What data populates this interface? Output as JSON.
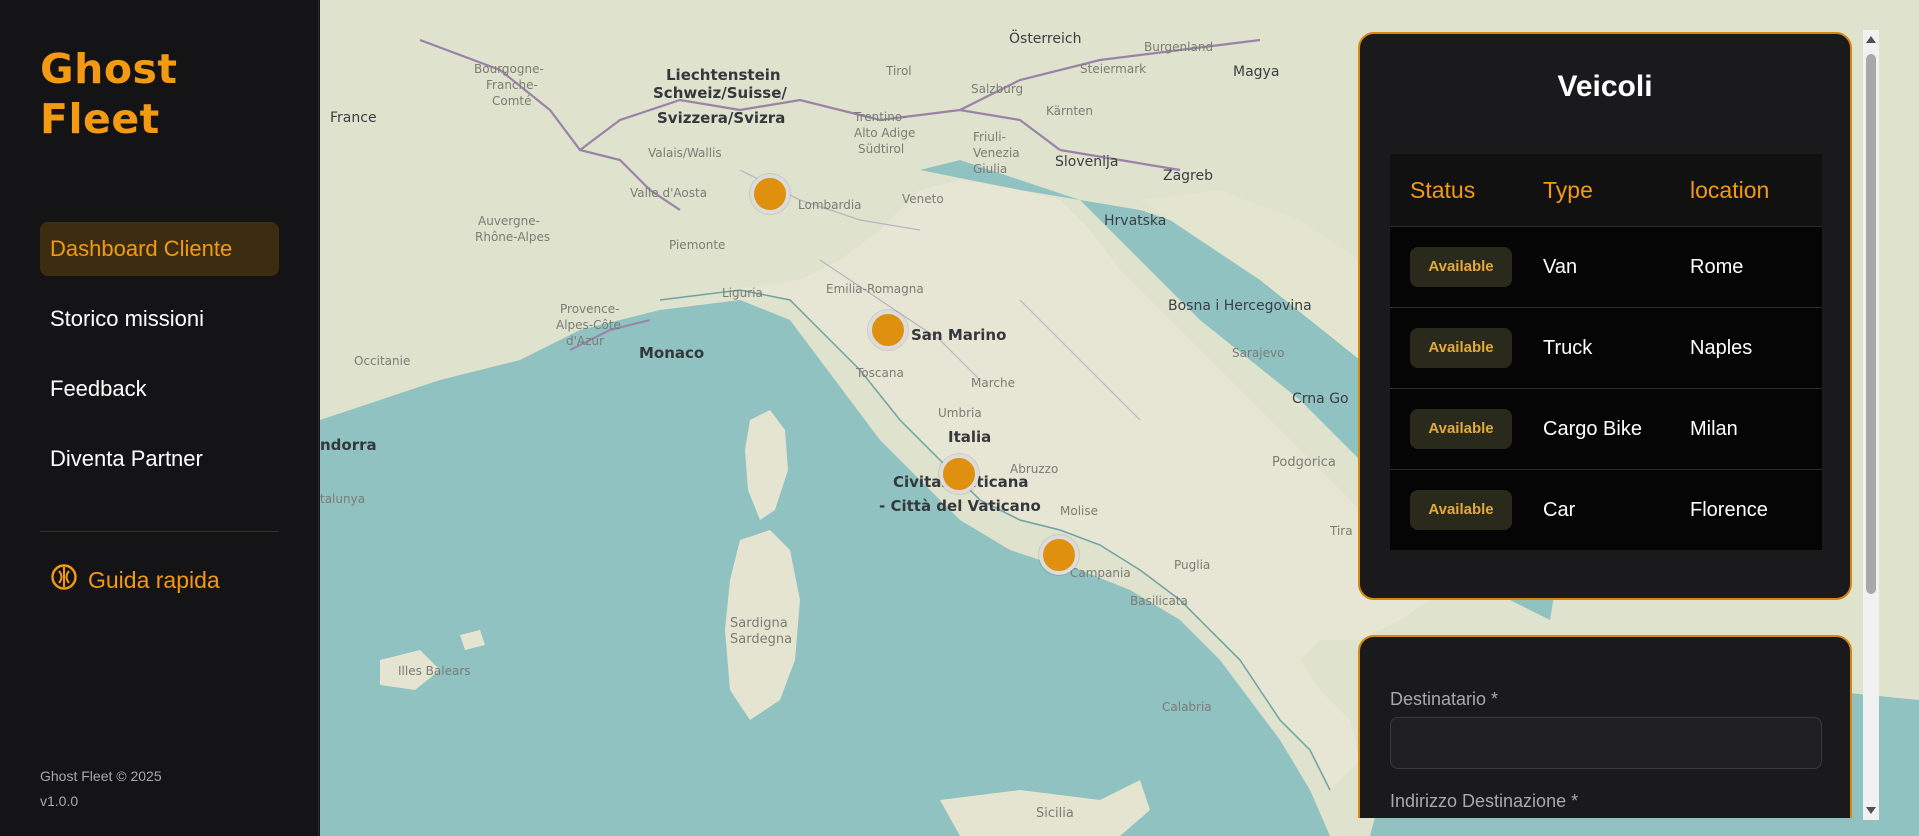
{
  "app": {
    "logo_line1": "Ghost",
    "logo_line2": "Fleet"
  },
  "sidebar": {
    "items": [
      {
        "label": "Dashboard Cliente",
        "active": true
      },
      {
        "label": "Storico missioni",
        "active": false
      },
      {
        "label": "Feedback",
        "active": false
      },
      {
        "label": "Diventa Partner",
        "active": false
      }
    ],
    "guide_label": "Guida rapida",
    "guide_icon": "help-circle-icon",
    "copyright": "Ghost Fleet © 2025",
    "version": "v1.0.0"
  },
  "map": {
    "labels": {
      "france": "France",
      "liechtenstein": "Liechtenstein",
      "switzerland1": "Schweiz/Suisse/",
      "switzerland2": "Svizzera/Svizra",
      "austria": "Österreich",
      "slovenia": "Slovenija",
      "zagreb": "Zagreb",
      "croatia": "Hrvatska",
      "bosnia": "Bosna i Hercegovina",
      "sarajevo": "Sarajevo",
      "monaco": "Monaco",
      "sanmarino": "San Marino",
      "italia": "Italia",
      "vatican1": "Civitas Vaticana",
      "vatican2": "- Città del Vaticano",
      "andorra": "ndorra",
      "podgorica": "Podgorica",
      "crnagora": "Crna Go",
      "magyar": "Magya",
      "sardegna1": "Sardigna",
      "sardegna2": "Sardegna",
      "baleares": "Illes Balears",
      "sicilia": "Sicilia",
      "puglia": "Puglia",
      "calabria": "Calabria",
      "campania": "Campania",
      "toscana": "Toscana",
      "lombardia": "Lombardia",
      "piemonte": "Piemonte",
      "liguria": "Liguria",
      "emilia": "Emilia-Romagna",
      "veneto": "Veneto",
      "marche": "Marche",
      "umbria": "Umbria",
      "abruzzo": "Abruzzo",
      "molise": "Molise",
      "basilicata": "Basilicata",
      "tirol": "Tirol",
      "occitanie": "Occitanie",
      "auvergne1": "Auvergne-",
      "auvergne2": "Rhône-Alpes",
      "bourgogne1": "Bourgogne-",
      "bourgogne2": "Franche-",
      "bourgogne3": "Comté",
      "provence1": "Provence-",
      "provence2": "Alpes-Côte",
      "provence3": "d'Azur",
      "valais": "Valais/Wallis",
      "valleaosta": "Valle d'Aosta",
      "trentino1": "Trentino-",
      "trentino2": "Alto Adige",
      "trentino3": "Südtirol",
      "friuli1": "Friuli-",
      "friuli2": "Venezia",
      "friuli3": "Giulia",
      "karnten": "Kärnten",
      "steiermark": "Steiermark",
      "salzburg": "Salzburg",
      "burgenland": "Burgenland",
      "tira": "Tira",
      "catalunya": "talunya"
    },
    "markers": [
      "marker-milan",
      "marker-florence",
      "marker-rome",
      "marker-naples"
    ]
  },
  "vehicles": {
    "title": "Veicoli",
    "columns": [
      "Status",
      "Type",
      "location"
    ],
    "rows": [
      {
        "status": "Available",
        "type": "Van",
        "location": "Rome"
      },
      {
        "status": "Available",
        "type": "Truck",
        "location": "Naples"
      },
      {
        "status": "Available",
        "type": "Cargo Bike",
        "location": "Milan"
      },
      {
        "status": "Available",
        "type": "Car",
        "location": "Florence"
      }
    ]
  },
  "form": {
    "recipient_label": "Destinatario *",
    "recipient_value": "",
    "address_label": "Indirizzo Destinazione *"
  },
  "colors": {
    "accent": "#f39a12",
    "sidebar_bg": "#141416",
    "sea": "#8fc2c0",
    "card_bg": "#1a1a1c"
  }
}
